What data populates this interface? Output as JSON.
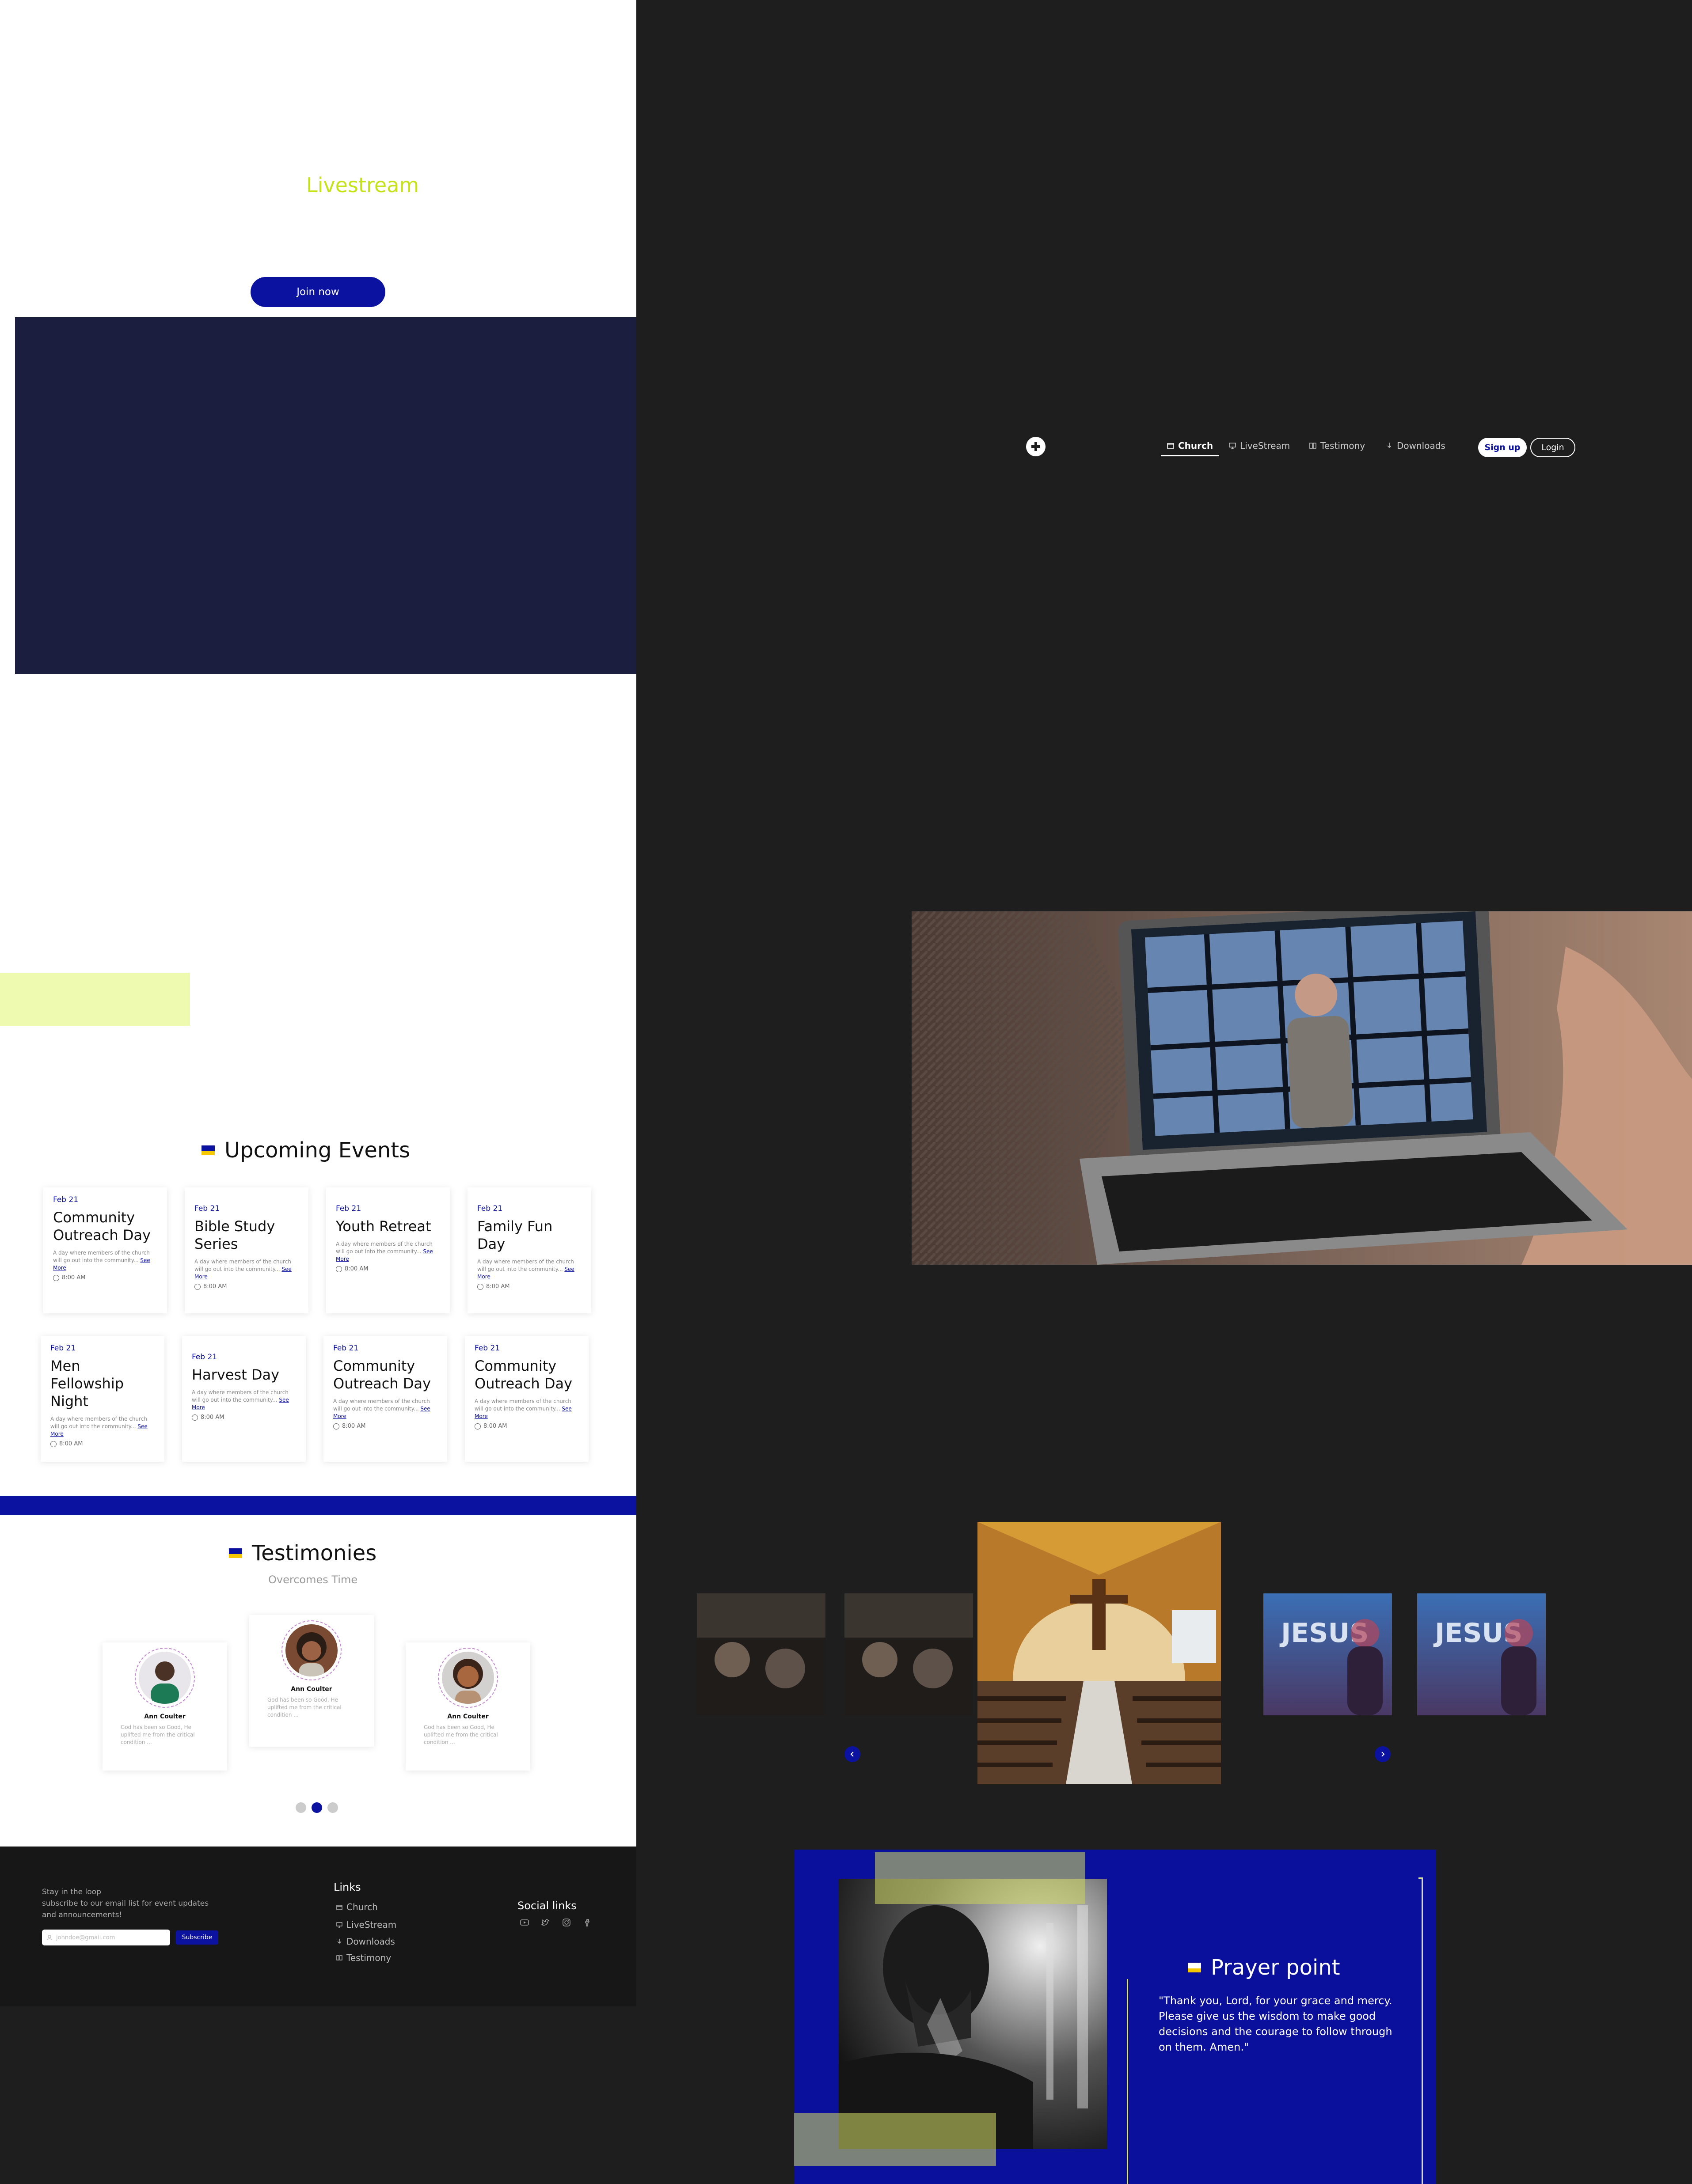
{
  "hero": {
    "title": "Livestream",
    "join_label": "Join now"
  },
  "nav": {
    "items": [
      {
        "label": "Church",
        "icon": "church-icon",
        "active": true
      },
      {
        "label": "LiveStream",
        "icon": "monitor-icon",
        "active": false
      },
      {
        "label": "Testimony",
        "icon": "book-icon",
        "active": false
      },
      {
        "label": "Downloads",
        "icon": "download-icon",
        "active": false
      }
    ],
    "signup_label": "Sign up",
    "login_label": "Login"
  },
  "events": {
    "title": "Upcoming Events",
    "see_more": "See More",
    "items": [
      {
        "date": "Feb 21",
        "title": "Community Outreach Day",
        "desc": "A day where members of the church will go out into the community...",
        "time": "8:00 AM"
      },
      {
        "date": "Feb 21",
        "title": "Bible Study Series",
        "desc": "A day where members of the church will go out into the community...",
        "time": "8:00 AM"
      },
      {
        "date": "Feb 21",
        "title": "Youth Retreat",
        "desc": "A day where members of the church will go out into the community...",
        "time": "8:00 AM"
      },
      {
        "date": "Feb 21",
        "title": "Family Fun Day",
        "desc": "A day where members of the church will go out into the community...",
        "time": "8:00 AM"
      },
      {
        "date": "Feb 21",
        "title": "Men Fellowship Night",
        "desc": "A day where members of the church will go out into the community...",
        "time": "8:00 AM"
      },
      {
        "date": "Feb 21",
        "title": "Harvest Day",
        "desc": "A day where members of the church will go out into the community...",
        "time": "8:00 AM"
      },
      {
        "date": "Feb 21",
        "title": "Community Outreach Day",
        "desc": "A day where members of the church will go out into the community...",
        "time": "8:00 AM"
      },
      {
        "date": "Feb 21",
        "title": "Community Outreach Day",
        "desc": "A day where members of the church will go out into the community...",
        "time": "8:00 AM"
      }
    ]
  },
  "testimonies": {
    "title": "Testimonies",
    "subtitle": "Overcomes Time",
    "items": [
      {
        "name": "Ann Coulter",
        "text": "God has been so Good, He uplifted me from the critical condition ..."
      },
      {
        "name": "Ann Coulter",
        "text": "God has been so Good, He uplifted me from the critical condition ..."
      },
      {
        "name": "Ann Coulter",
        "text": "God has been so Good, He uplifted me from the critical condition ..."
      }
    ],
    "active_dot": 1
  },
  "footer": {
    "loop_title": "Stay in the loop",
    "loop_text_1": "subscribe to our email list for event updates",
    "loop_text_2": "and announcements!",
    "email_placeholder": "johndoe@gmail.com",
    "subscribe_label": "Subscribe",
    "links_title": "Links",
    "links": [
      {
        "label": "Church",
        "icon": "church-icon"
      },
      {
        "label": "LiveStream",
        "icon": "monitor-icon"
      },
      {
        "label": "Downloads",
        "icon": "download-icon"
      },
      {
        "label": "Testimony",
        "icon": "book-icon"
      }
    ],
    "social_title": "Social links",
    "social": [
      "youtube-icon",
      "twitter-icon",
      "instagram-icon",
      "facebook-icon"
    ]
  },
  "prayer": {
    "title": "Prayer point",
    "text": "\"Thank you, Lord, for your grace and mercy. Please give us the wisdom to make good decisions and the courage to follow through on them. Amen.\""
  },
  "colors": {
    "accent_blue": "#0c12a0",
    "lime": "#c6e21b",
    "navy": "#1b1e3f",
    "dark_bg": "#1e1e1e"
  }
}
